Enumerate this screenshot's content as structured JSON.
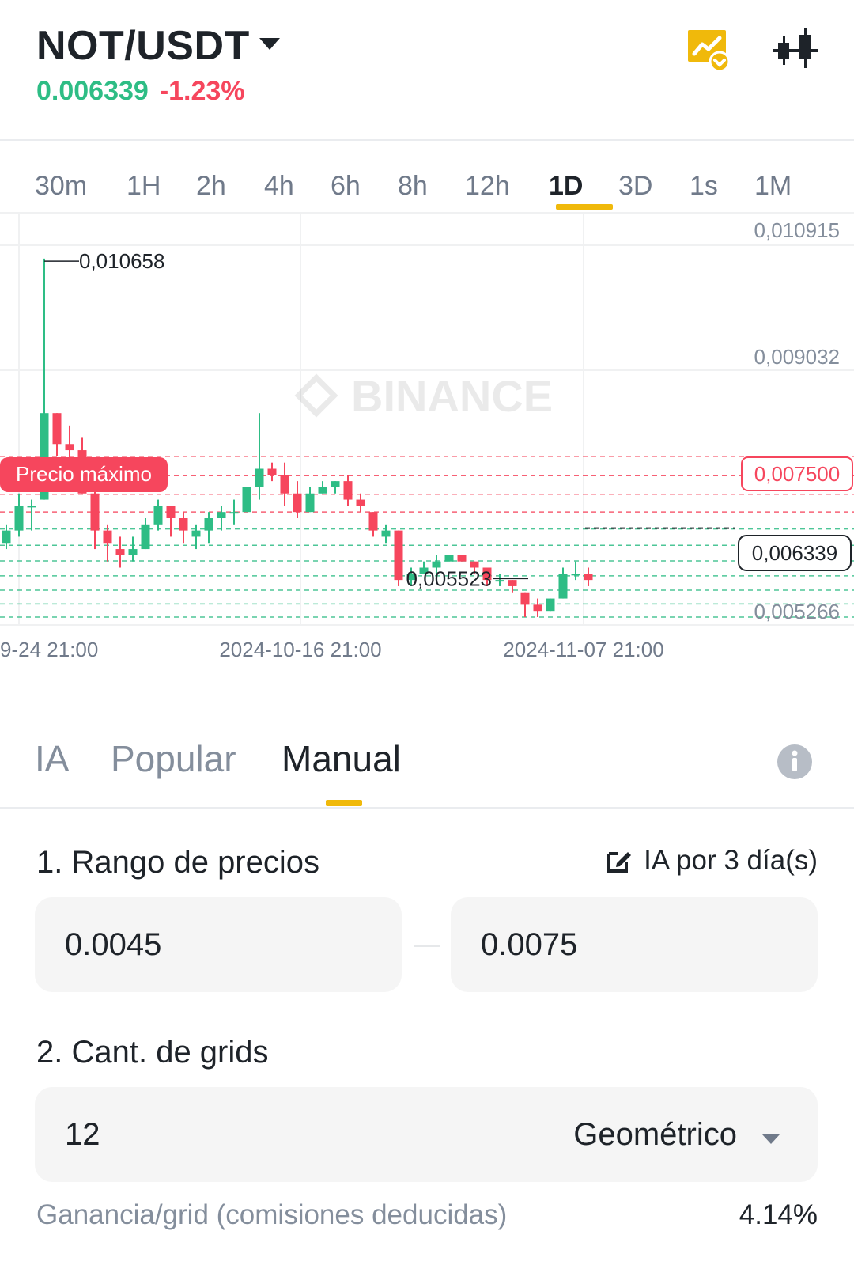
{
  "header": {
    "pair": "NOT/USDT",
    "last_price": "0.006339",
    "change_pct": "-1.23%",
    "icons": [
      "strategy-chart-icon",
      "candlestick-icon"
    ],
    "colors": {
      "up": "#2ebd85",
      "down": "#f6465d",
      "accent": "#f0b90b"
    }
  },
  "timeframes": {
    "items": [
      "30m",
      "1H",
      "2h",
      "4h",
      "6h",
      "8h",
      "12h",
      "1D",
      "3D",
      "1s",
      "1M"
    ],
    "active": "1D"
  },
  "chart_data": {
    "type": "candlestick",
    "watermark": "BINANCE",
    "y_axis_labels": [
      "0,010915",
      "0,009032",
      "0,007500",
      "0,006339",
      "0,005266"
    ],
    "x_axis_labels": [
      "9-24 21:00",
      "2024-10-16 21:00",
      "2024-11-07 21:00"
    ],
    "ylim": [
      0.0049,
      0.0113
    ],
    "high_annotation": "0,010658",
    "low_annotation": "0,005523",
    "max_price_badge": "Precio máximo",
    "max_price_level": "0,007500",
    "current_price_tag": "0,006339",
    "grid_upper": 0.0075,
    "grid_count": 12,
    "candles": [
      [
        0.0061,
        0.0064,
        0.006,
        0.0063
      ],
      [
        0.0063,
        0.0069,
        0.0062,
        0.0067
      ],
      [
        0.0067,
        0.0068,
        0.0063,
        0.0067
      ],
      [
        0.0068,
        0.0107,
        0.0068,
        0.0082
      ],
      [
        0.0082,
        0.0082,
        0.0075,
        0.0077
      ],
      [
        0.0077,
        0.008,
        0.0071,
        0.0076
      ],
      [
        0.0076,
        0.0078,
        0.0069,
        0.0069
      ],
      [
        0.0069,
        0.0073,
        0.006,
        0.0063
      ],
      [
        0.0063,
        0.0064,
        0.0058,
        0.0061
      ],
      [
        0.006,
        0.0062,
        0.0057,
        0.0059
      ],
      [
        0.0059,
        0.0062,
        0.0058,
        0.006
      ],
      [
        0.006,
        0.0065,
        0.006,
        0.0064
      ],
      [
        0.0064,
        0.0068,
        0.0063,
        0.0067
      ],
      [
        0.0067,
        0.0067,
        0.0062,
        0.0065
      ],
      [
        0.0065,
        0.0066,
        0.0061,
        0.0063
      ],
      [
        0.0062,
        0.0064,
        0.006,
        0.0063
      ],
      [
        0.0063,
        0.0066,
        0.0061,
        0.0065
      ],
      [
        0.0065,
        0.0067,
        0.0063,
        0.0066
      ],
      [
        0.0066,
        0.0068,
        0.0064,
        0.0066
      ],
      [
        0.0066,
        0.007,
        0.0066,
        0.007
      ],
      [
        0.007,
        0.0082,
        0.0068,
        0.0073
      ],
      [
        0.0073,
        0.0074,
        0.0071,
        0.0072
      ],
      [
        0.0072,
        0.0074,
        0.0067,
        0.0069
      ],
      [
        0.0069,
        0.0071,
        0.0065,
        0.0066
      ],
      [
        0.0066,
        0.007,
        0.0066,
        0.0069
      ],
      [
        0.0069,
        0.0071,
        0.0069,
        0.007
      ],
      [
        0.007,
        0.0071,
        0.0069,
        0.0071
      ],
      [
        0.0071,
        0.0072,
        0.0067,
        0.0068
      ],
      [
        0.0068,
        0.0069,
        0.0066,
        0.0067
      ],
      [
        0.0066,
        0.0066,
        0.0062,
        0.0063
      ],
      [
        0.0062,
        0.0064,
        0.0061,
        0.0063
      ],
      [
        0.0063,
        0.0063,
        0.0054,
        0.0055
      ],
      [
        0.0055,
        0.0057,
        0.0054,
        0.0056
      ],
      [
        0.0056,
        0.0058,
        0.0056,
        0.0057
      ],
      [
        0.0057,
        0.0059,
        0.0055,
        0.0058
      ],
      [
        0.0058,
        0.0059,
        0.0058,
        0.0059
      ],
      [
        0.0059,
        0.0059,
        0.0058,
        0.0058
      ],
      [
        0.0058,
        0.0058,
        0.0056,
        0.0057
      ],
      [
        0.0057,
        0.0057,
        0.0054,
        0.0055
      ],
      [
        0.0055,
        0.0056,
        0.0054,
        0.0055
      ],
      [
        0.0055,
        0.0055,
        0.0053,
        0.0054
      ],
      [
        0.0053,
        0.0053,
        0.0049,
        0.0051
      ],
      [
        0.0051,
        0.0052,
        0.0049,
        0.005
      ],
      [
        0.005,
        0.0052,
        0.005,
        0.0052
      ],
      [
        0.0052,
        0.0057,
        0.0052,
        0.0056
      ],
      [
        0.0056,
        0.0058,
        0.0055,
        0.0056
      ],
      [
        0.0056,
        0.0057,
        0.0054,
        0.0055
      ]
    ]
  },
  "strategy_tabs": {
    "items": [
      "IA",
      "Popular",
      "Manual"
    ],
    "active": "Manual"
  },
  "price_range": {
    "title": "1. Rango de precios",
    "ai_link": "IA por 3 día(s)",
    "lower": "0.0045",
    "upper": "0.0075"
  },
  "grids": {
    "title": "2. Cant. de grids",
    "count": "12",
    "mode": "Geométrico"
  },
  "profit": {
    "label": "Ganancia/grid (comisiones deducidas)",
    "value": "4.14%"
  }
}
